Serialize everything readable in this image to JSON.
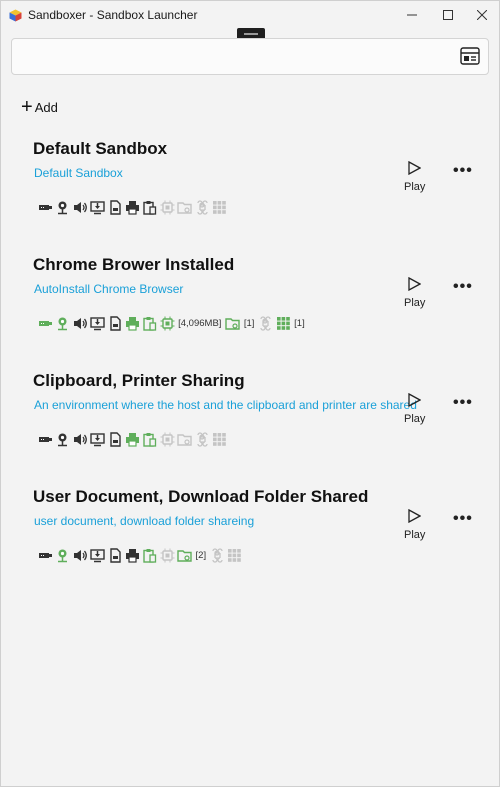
{
  "window": {
    "title": "Sandboxer - Sandbox Launcher"
  },
  "search": {
    "value": "",
    "placeholder": ""
  },
  "toolbar": {
    "add_label": "Add"
  },
  "colors": {
    "accent": "#1aa0d8",
    "enabled": "#5fae5b",
    "normal": "#333333",
    "disabled": "#c4c4c4"
  },
  "cards": [
    {
      "title": "Default Sandbox",
      "description": "Default Sandbox",
      "play_label": "Play",
      "more_label": "•••",
      "icons": [
        {
          "name": "network-icon",
          "state": "normal"
        },
        {
          "name": "vgpu-icon",
          "state": "normal"
        },
        {
          "name": "audio-icon",
          "state": "normal"
        },
        {
          "name": "download-icon",
          "state": "normal"
        },
        {
          "name": "document-icon",
          "state": "normal"
        },
        {
          "name": "printer-icon",
          "state": "normal"
        },
        {
          "name": "clipboard-icon",
          "state": "normal"
        },
        {
          "name": "memory-icon",
          "state": "disabled"
        },
        {
          "name": "mapped-folder-icon",
          "state": "disabled"
        },
        {
          "name": "command-icon",
          "state": "disabled"
        },
        {
          "name": "grid-icon",
          "state": "disabled"
        }
      ],
      "memory_label": "",
      "folder_count": "",
      "grid_count": ""
    },
    {
      "title": "Chrome Brower Installed",
      "description": "AutoInstall Chrome Browser",
      "play_label": "Play",
      "more_label": "•••",
      "icons": [
        {
          "name": "network-icon",
          "state": "enabled"
        },
        {
          "name": "vgpu-icon",
          "state": "enabled"
        },
        {
          "name": "audio-icon",
          "state": "normal"
        },
        {
          "name": "download-icon",
          "state": "normal"
        },
        {
          "name": "document-icon",
          "state": "normal"
        },
        {
          "name": "printer-icon",
          "state": "enabled"
        },
        {
          "name": "clipboard-icon",
          "state": "enabled"
        },
        {
          "name": "memory-icon",
          "state": "enabled"
        },
        {
          "name": "mapped-folder-icon",
          "state": "enabled"
        },
        {
          "name": "command-icon",
          "state": "disabled"
        },
        {
          "name": "grid-icon",
          "state": "enabled"
        }
      ],
      "memory_label": "[4,096MB]",
      "folder_count": "[1]",
      "grid_count": "[1]"
    },
    {
      "title": "Clipboard, Printer Sharing",
      "description": "An environment where the host and the clipboard and printer are shared",
      "play_label": "Play",
      "more_label": "•••",
      "icons": [
        {
          "name": "network-icon",
          "state": "normal"
        },
        {
          "name": "vgpu-icon",
          "state": "normal"
        },
        {
          "name": "audio-icon",
          "state": "normal"
        },
        {
          "name": "download-icon",
          "state": "normal"
        },
        {
          "name": "document-icon",
          "state": "normal"
        },
        {
          "name": "printer-icon",
          "state": "enabled"
        },
        {
          "name": "clipboard-icon",
          "state": "enabled"
        },
        {
          "name": "memory-icon",
          "state": "disabled"
        },
        {
          "name": "mapped-folder-icon",
          "state": "disabled"
        },
        {
          "name": "command-icon",
          "state": "disabled"
        },
        {
          "name": "grid-icon",
          "state": "disabled"
        }
      ],
      "memory_label": "",
      "folder_count": "",
      "grid_count": ""
    },
    {
      "title": "User Document, Download Folder Shared",
      "description": "user document, download folder shareing",
      "play_label": "Play",
      "more_label": "•••",
      "icons": [
        {
          "name": "network-icon",
          "state": "normal"
        },
        {
          "name": "vgpu-icon",
          "state": "enabled"
        },
        {
          "name": "audio-icon",
          "state": "normal"
        },
        {
          "name": "download-icon",
          "state": "normal"
        },
        {
          "name": "document-icon",
          "state": "normal"
        },
        {
          "name": "printer-icon",
          "state": "normal"
        },
        {
          "name": "clipboard-icon",
          "state": "enabled"
        },
        {
          "name": "memory-icon",
          "state": "disabled"
        },
        {
          "name": "mapped-folder-icon",
          "state": "enabled"
        },
        {
          "name": "command-icon",
          "state": "disabled"
        },
        {
          "name": "grid-icon",
          "state": "disabled"
        }
      ],
      "memory_label": "",
      "folder_count": "[2]",
      "grid_count": ""
    }
  ]
}
